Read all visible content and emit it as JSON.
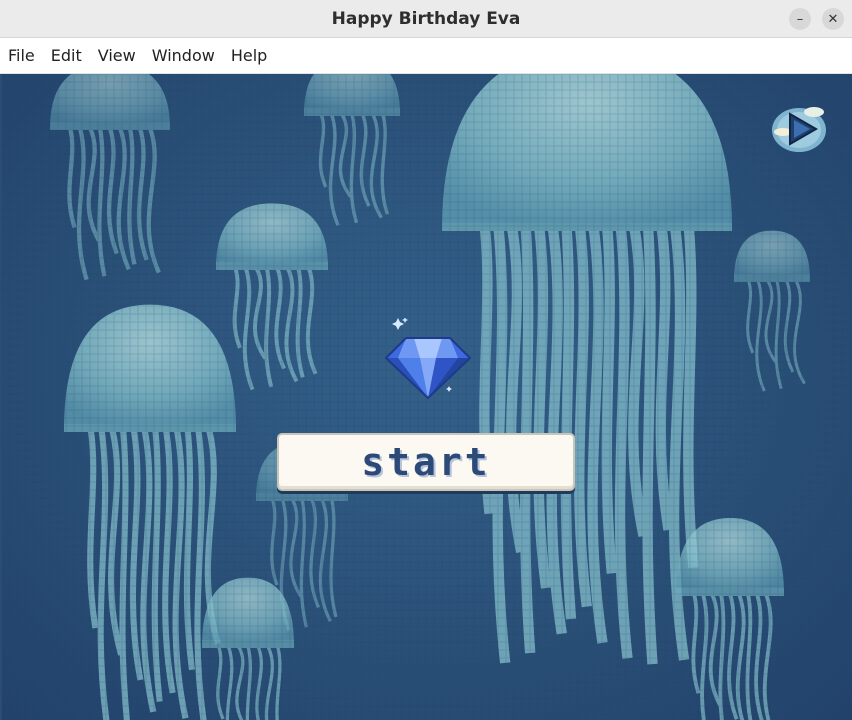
{
  "window": {
    "title": "Happy Birthday Eva",
    "minimize_glyph": "–",
    "close_glyph": "✕"
  },
  "menu": [
    "File",
    "Edit",
    "View",
    "Window",
    "Help"
  ],
  "game": {
    "start_label": "start",
    "play_icon": "play-cloud-icon",
    "gem_icon": "blue-diamond-icon",
    "background": "pixel-art jellyfish underwater",
    "colors": {
      "water": "#2a5078",
      "jelly": "#8cc7cf",
      "button_bg": "#fbf9f2",
      "button_text": "#2c4a78",
      "gem": "#4f7fe8"
    }
  }
}
